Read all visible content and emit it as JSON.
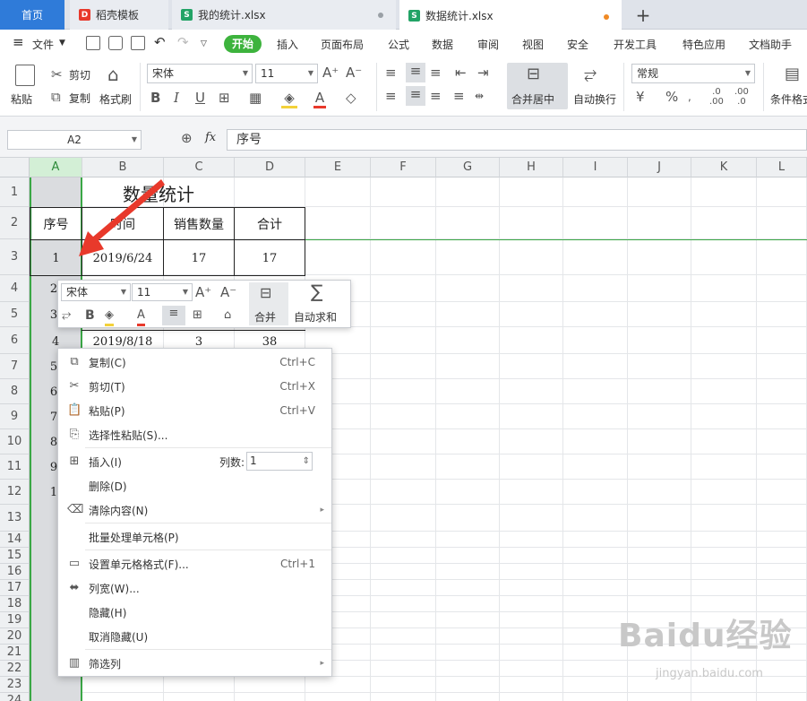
{
  "tabs": {
    "home": "首页",
    "template": "稻壳模板",
    "file1": "我的统计.xlsx",
    "file2": "数据统计.xlsx",
    "new_tab": "+"
  },
  "colors": {
    "accent": "#2f7bd9",
    "start_green": "#3db33d",
    "unsaved_dot": "#f08a24",
    "saved_dot": "#9aa0a6",
    "arrow": "#e8392b",
    "selection": "#3aa745"
  },
  "menu": {
    "file": "文件",
    "start": "开始",
    "insert": "插入",
    "page_layout": "页面布局",
    "formula": "公式",
    "data": "数据",
    "review": "审阅",
    "view": "视图",
    "security": "安全",
    "dev": "开发工具",
    "special": "特色应用",
    "doc_helper": "文档助手"
  },
  "ribbon": {
    "paste": "粘贴",
    "cut": "剪切",
    "copy": "复制",
    "format_painter": "格式刷",
    "font": "宋体",
    "size": "11",
    "merge_center": "合并居中",
    "wrap": "自动换行",
    "number_format": "常规",
    "conditional_format": "条件格式"
  },
  "formula_bar": {
    "cell_ref": "A2",
    "fx": "fx",
    "content": "序号"
  },
  "columns": [
    "A",
    "B",
    "C",
    "D",
    "E",
    "F",
    "G",
    "H",
    "I",
    "J",
    "K",
    "L"
  ],
  "rows": [
    "1",
    "2",
    "3",
    "4",
    "5",
    "6",
    "7",
    "8",
    "9",
    "10",
    "11",
    "12",
    "13",
    "14",
    "15",
    "16",
    "17",
    "18",
    "19",
    "20",
    "21",
    "22",
    "23",
    "24"
  ],
  "sheet": {
    "title": "数量统计",
    "headers": [
      "序号",
      "时间",
      "销售数量",
      "合计"
    ],
    "row3": [
      "1",
      "2019/6/24",
      "17",
      "17"
    ],
    "row6": [
      "4",
      "2019/8/18",
      "3",
      "38"
    ],
    "a_partial": [
      "2",
      "3",
      "5",
      "6",
      "7",
      "8",
      "9",
      "1"
    ]
  },
  "mini_toolbar": {
    "font": "宋体",
    "size": "11",
    "merge": "合并",
    "autosum": "自动求和"
  },
  "context_menu": [
    {
      "label": "复制(C)",
      "shortcut": "Ctrl+C",
      "icon": "copy-icon"
    },
    {
      "label": "剪切(T)",
      "shortcut": "Ctrl+X",
      "icon": "scissors-icon"
    },
    {
      "label": "粘贴(P)",
      "shortcut": "Ctrl+V",
      "icon": "paste-icon"
    },
    {
      "label": "选择性粘贴(S)...",
      "shortcut": "",
      "icon": "paste-special-icon"
    },
    {
      "label": "插入(I)",
      "shortcut": "",
      "icon": "insert-icon",
      "extra_label": "列数:",
      "extra_value": "1"
    },
    {
      "label": "删除(D)",
      "shortcut": "",
      "icon": ""
    },
    {
      "label": "清除内容(N)",
      "shortcut": "",
      "icon": "eraser-icon"
    },
    {
      "label": "批量处理单元格(P)",
      "shortcut": "",
      "icon": ""
    },
    {
      "label": "设置单元格格式(F)...",
      "shortcut": "Ctrl+1",
      "icon": "format-cells-icon"
    },
    {
      "label": "列宽(W)...",
      "shortcut": "",
      "icon": "column-width-icon"
    },
    {
      "label": "隐藏(H)",
      "shortcut": "",
      "icon": ""
    },
    {
      "label": "取消隐藏(U)",
      "shortcut": "",
      "icon": ""
    },
    {
      "label": "筛选列",
      "shortcut": "",
      "icon": "filter-columns-icon"
    }
  ],
  "watermark": {
    "main": "Baidu经验",
    "sub": "jingyan.baidu.com"
  }
}
